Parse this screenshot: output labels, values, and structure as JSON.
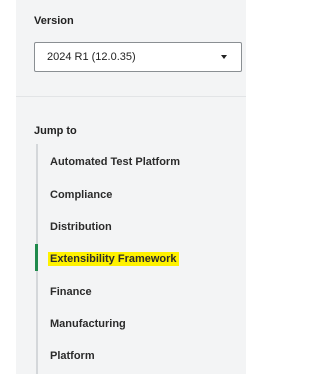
{
  "version": {
    "label": "Version",
    "selected": "2024 R1 (12.0.35)"
  },
  "jump_to": {
    "label": "Jump to",
    "items": [
      {
        "label": "Automated Test Platform",
        "active": false
      },
      {
        "label": "Compliance",
        "active": false
      },
      {
        "label": "Distribution",
        "active": false
      },
      {
        "label": "Extensibility Framework",
        "active": true
      },
      {
        "label": "Finance",
        "active": false
      },
      {
        "label": "Manufacturing",
        "active": false
      },
      {
        "label": "Platform",
        "active": false
      }
    ]
  },
  "colors": {
    "panel_bg": "#f3f4f5",
    "active_indicator": "#1f8a4c",
    "highlight": "#fff200",
    "text": "#222222"
  }
}
